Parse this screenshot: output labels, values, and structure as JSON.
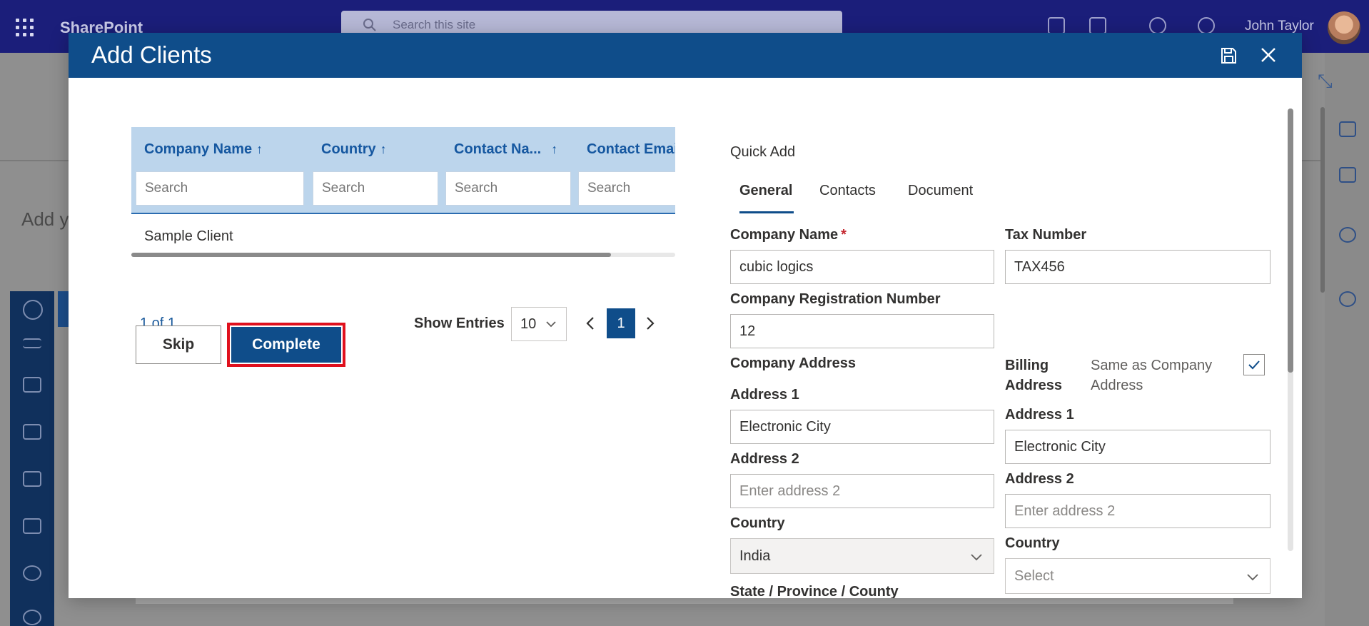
{
  "sharepoint": {
    "brand": "SharePoint",
    "search_placeholder": "Search this site",
    "user_name": "John Taylor",
    "page_text": "Add y"
  },
  "dialog": {
    "title": "Add Clients"
  },
  "grid": {
    "columns": [
      {
        "label": "Company Name",
        "sort": "↑"
      },
      {
        "label": "Country",
        "sort": "↑"
      },
      {
        "label": "Contact Na...",
        "sort": "↑"
      },
      {
        "label": "Contact Emai",
        "sort": ""
      }
    ],
    "search_placeholder": "Search",
    "rows": [
      {
        "company_name": "Sample Client"
      }
    ],
    "page_info": "1 of 1",
    "show_entries_label": "Show Entries",
    "entries_value": "10",
    "current_page": "1"
  },
  "buttons": {
    "skip": "Skip",
    "complete": "Complete"
  },
  "quick_add": {
    "title": "Quick Add",
    "tabs": [
      "General",
      "Contacts",
      "Document"
    ],
    "active_tab": "General",
    "fields": {
      "company_name_label": "Company Name",
      "company_name_required": "*",
      "company_name_value": "cubic logics",
      "tax_number_label": "Tax Number",
      "tax_number_value": "TAX456",
      "reg_number_label": "Company Registration Number",
      "reg_number_value": "12",
      "company_address_label": "Company Address",
      "billing_address_label": "Billing Address",
      "same_as_label": "Same as Company Address",
      "same_as_checked": true,
      "address1_label": "Address 1",
      "address1_value": "Electronic City",
      "address2_label": "Address 2",
      "address2_placeholder": "Enter address 2",
      "country_label": "Country",
      "country_value": "India",
      "billing_address1_label": "Address 1",
      "billing_address1_value": "Electronic City",
      "billing_address2_label": "Address 2",
      "billing_address2_placeholder": "Enter address 2",
      "billing_country_label": "Country",
      "billing_country_placeholder": "Select",
      "state_label": "State / Province / County"
    }
  },
  "colors": {
    "header_blue": "#0f4d8a",
    "grid_header_bg": "#bcd5ec",
    "highlight_red": "#e0101d",
    "sp_topbar": "#1b1e7a"
  }
}
